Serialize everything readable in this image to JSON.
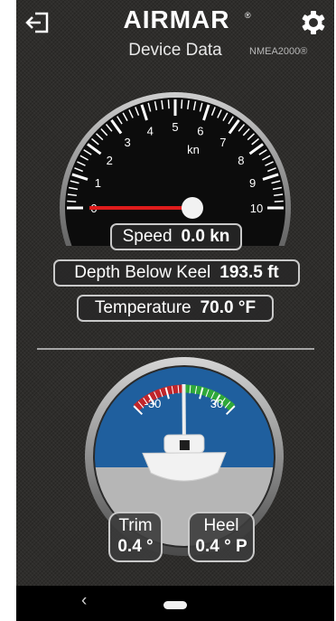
{
  "header": {
    "brand": "AIRMAR",
    "brand_mark": "®",
    "title": "Device Data",
    "network": "NMEA2000®",
    "exit_icon": "exit-icon",
    "settings_icon": "gear-icon"
  },
  "speed_gauge": {
    "unit": "kn",
    "ticks": [
      "0",
      "1",
      "2",
      "3",
      "4",
      "5",
      "6",
      "7",
      "8",
      "9",
      "10"
    ],
    "value": 0.0,
    "min": 0,
    "max": 10
  },
  "readouts": {
    "speed_label": "Speed",
    "speed_value": "0.0 kn",
    "depth_label": "Depth Below Keel",
    "depth_value": "193.5 ft",
    "temp_label": "Temperature",
    "temp_value": "70.0 °F"
  },
  "attitude": {
    "left_scale": "-30",
    "right_scale": "30",
    "heel_degrees": 0.4,
    "trim_label": "Trim",
    "trim_value": "0.4 °",
    "heel_label": "Heel",
    "heel_value": "0.4 ° P"
  },
  "colors": {
    "needle": "#e01c1c",
    "port_arc": "#c0262b",
    "starboard_arc": "#2fa83a",
    "sky": "#1f5f9e",
    "water": "#b6b6b6"
  },
  "nav": {
    "back": "‹",
    "home_icon": "home-pill-icon"
  }
}
